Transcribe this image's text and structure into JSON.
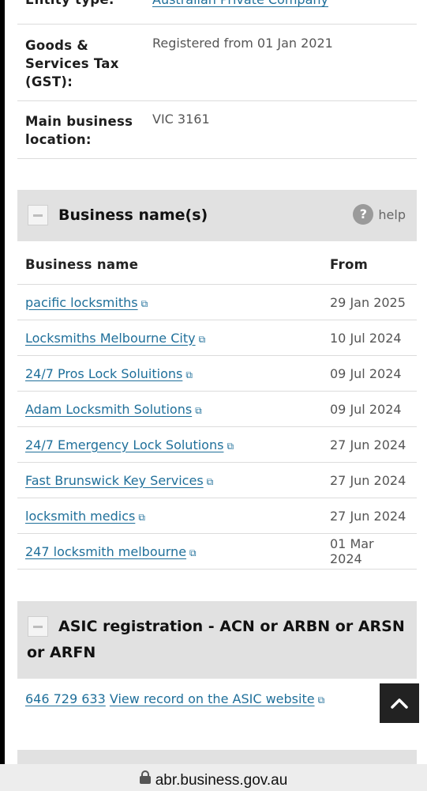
{
  "details": {
    "entity_type_label": "Entity type:",
    "entity_type_value": "Australian Private Company",
    "gst_label_line1": "Goods &",
    "gst_label_line2": "Services Tax",
    "gst_label_line3": "(GST):",
    "gst_value": "Registered from 01 Jan 2021",
    "location_label_line1": "Main business",
    "location_label_line2": "location:",
    "location_value": "VIC 3161"
  },
  "business_names": {
    "title": "Business name(s)",
    "help_icon_glyph": "?",
    "help_label": "help",
    "col_name": "Business name",
    "col_from": "From",
    "rows": [
      {
        "name": "pacific locksmiths",
        "from": "29 Jan 2025"
      },
      {
        "name": "Locksmiths Melbourne City",
        "from": "10 Jul 2024"
      },
      {
        "name": "24/7 Pros Lock Soluitions",
        "from": "09 Jul 2024"
      },
      {
        "name": "Adam Locksmith Solutions",
        "from": "09 Jul 2024"
      },
      {
        "name": "24/7 Emergency Lock Solutions",
        "from": "27 Jun 2024"
      },
      {
        "name": "Fast Brunswick Key Services",
        "from": "27 Jun 2024"
      },
      {
        "name": "locksmith medics",
        "from": "27 Jun 2024"
      },
      {
        "name": "247 locksmith melbourne",
        "from": "01 Mar 2024"
      }
    ]
  },
  "asic": {
    "title_line1": "ASIC registration - ACN or ARBN or ARSN",
    "title_line2": "or ARFN",
    "acn": "646 729 633",
    "link_text": "View record on the ASIC website"
  },
  "browser": {
    "url": "abr.business.gov.au"
  },
  "icons": {
    "external_link": "external-link-icon",
    "collapse": "minus-icon",
    "help": "question-circle-icon",
    "scroll_top": "chevron-up-icon",
    "lock": "lock-icon"
  }
}
